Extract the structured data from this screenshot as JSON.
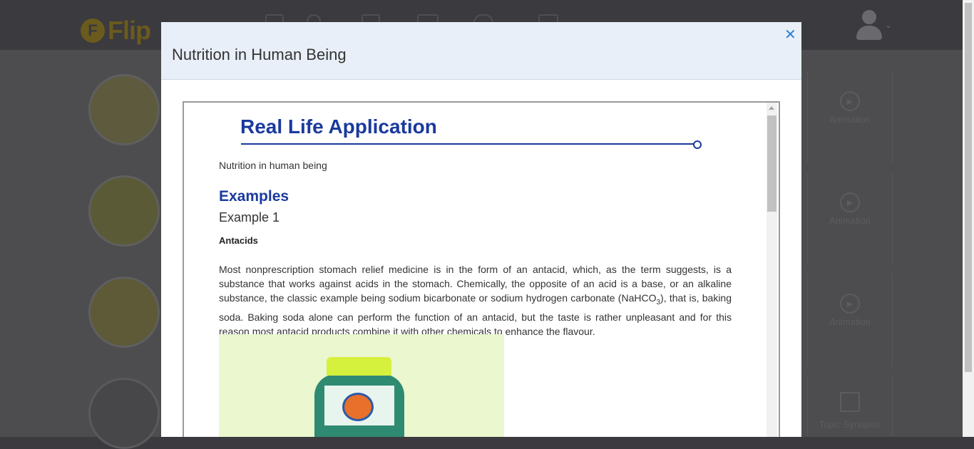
{
  "app": {
    "logo_letter": "F",
    "logo_text": "Flip",
    "nav_icons": [
      "book-icon",
      "person-icon",
      "list-icon",
      "mail-icon",
      "gamepad-icon",
      "envelope-icon"
    ],
    "user_avatar_icon": "user-avatar-icon",
    "user_caret": "⌄"
  },
  "side_cards": [
    {
      "icon": "play-icon",
      "label": "Animation"
    },
    {
      "icon": "play-icon",
      "label": "Animation"
    },
    {
      "icon": "play-icon",
      "label": "Animation"
    },
    {
      "icon": "document-icon",
      "label": "Topic Synopsis"
    }
  ],
  "modal": {
    "title": "Nutrition in Human Being",
    "close_glyph": "✕"
  },
  "content": {
    "heading": "Real Life Application",
    "subtitle": "Nutrition in human being",
    "examples_heading": "Examples",
    "example_label": "Example 1",
    "example_title": "Antacids",
    "paragraph_part1": "Most nonprescription stomach relief medicine is in the form of an antacid, which, as the term suggests, is a substance that works against acids in the stomach. Chemically, the opposite of an acid is a base, or an alkaline substance, the classic example being sodium bicarbonate or sodium hydrogen carbonate (NaHCO",
    "paragraph_sub": "3",
    "paragraph_part2": "), that is, baking soda. Baking soda alone can perform the function of an antacid, but the taste is rather unpleasant and for this reason most antacid products combine it with other chemicals to enhance the flavour.",
    "image_name": "antacid-bottle-image"
  },
  "colors": {
    "heading_blue": "#1a3a9c",
    "header_bg": "#e8eff8",
    "close_blue": "#2a7fd4",
    "backdrop": "#4d4d4f"
  }
}
